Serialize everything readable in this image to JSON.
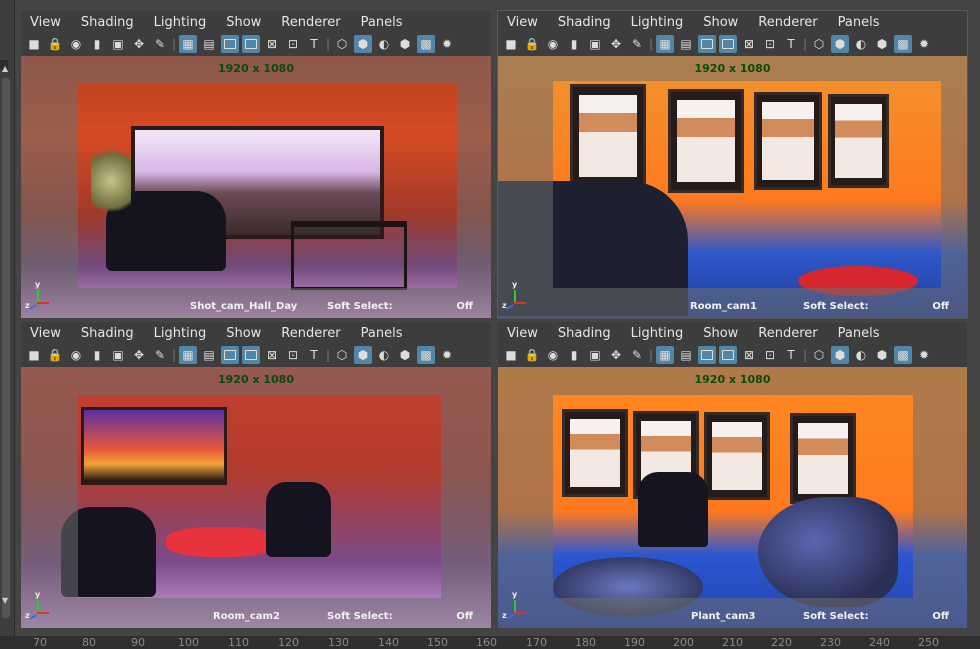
{
  "menus": [
    "View",
    "Shading",
    "Lighting",
    "Show",
    "Renderer",
    "Panels"
  ],
  "toolbar_icons": [
    "camera-icon",
    "camera-lock-icon",
    "camera-attributes-icon",
    "bookmark-icon",
    "image-plane-icon",
    "2d-pan-zoom-icon",
    "grease-pencil-icon",
    "grid-icon",
    "film-gate-icon",
    "resolution-gate-icon",
    "gate-mask-icon",
    "field-chart-icon",
    "safe-action-icon",
    "safe-title-icon",
    "wireframe-icon",
    "smooth-shade-icon",
    "default-material-icon",
    "wireframe-on-shaded-icon",
    "textured-icon",
    "use-all-lights-icon"
  ],
  "viewports": [
    {
      "resolution": "1920 x 1080",
      "camera": "Shot_cam_Hall_Day",
      "soft_select_label": "Soft Select:",
      "soft_select_value": "Off"
    },
    {
      "resolution": "1920 x 1080",
      "camera": "Room_cam1",
      "soft_select_label": "Soft Select:",
      "soft_select_value": "Off"
    },
    {
      "resolution": "1920 x 1080",
      "camera": "Room_cam2",
      "soft_select_label": "Soft Select:",
      "soft_select_value": "Off"
    },
    {
      "resolution": "1920 x 1080",
      "camera": "Plant_cam3",
      "soft_select_label": "Soft Select:",
      "soft_select_value": "Off"
    }
  ],
  "axis_labels": {
    "x": "x",
    "y": "y",
    "z": "z"
  },
  "timeline_ticks": [
    "70",
    "80",
    "90",
    "100",
    "110",
    "120",
    "130",
    "140",
    "150",
    "160",
    "170",
    "180",
    "190",
    "200",
    "210",
    "220",
    "230",
    "240",
    "250"
  ]
}
